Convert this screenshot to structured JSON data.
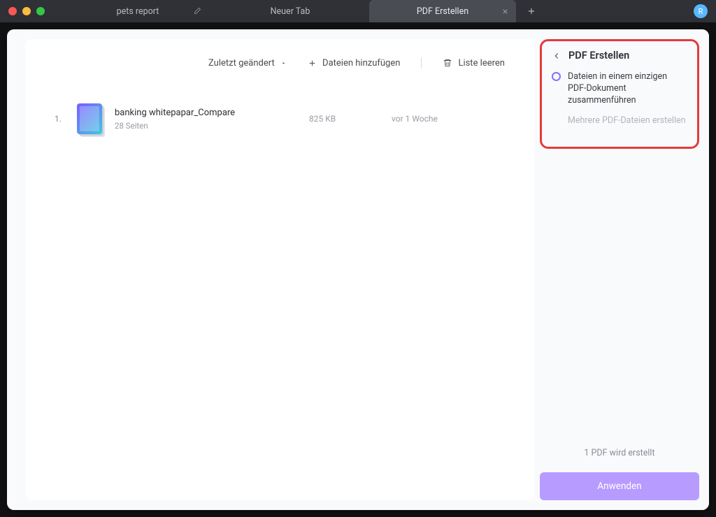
{
  "titlebar": {
    "tabs": [
      {
        "label": "pets report"
      },
      {
        "label": "Neuer Tab"
      },
      {
        "label": "PDF Erstellen"
      }
    ],
    "avatar_letter": "R"
  },
  "toolbar": {
    "sort_label": "Zuletzt geändert",
    "add_label": "Dateien hinzufügen",
    "clear_label": "Liste leeren"
  },
  "files": [
    {
      "index": "1.",
      "name": "banking whitepapar_Compare",
      "pages": "28 Seiten",
      "size": "825 KB",
      "date": "vor 1 Woche"
    }
  ],
  "sidebar": {
    "title": "PDF Erstellen",
    "option_merge": "Dateien in einem einzigen PDF-Dokument zusammenführen",
    "option_multiple": "Mehrere PDF-Dateien erstellen",
    "status": "1 PDF wird erstellt",
    "apply_label": "Anwenden"
  }
}
